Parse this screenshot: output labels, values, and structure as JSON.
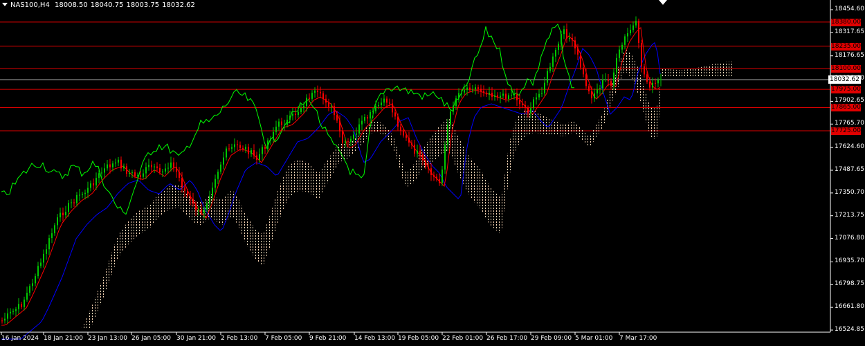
{
  "header": {
    "symbol": "NAS100,H4",
    "open": "18008.50",
    "high": "18040.75",
    "low": "18003.75",
    "close": "18032.62"
  },
  "y_axis": [
    {
      "label": "18454.60",
      "value": 18454.6
    },
    {
      "label": "18317.65",
      "value": 18317.65
    },
    {
      "label": "18176.65",
      "value": 18176.65
    },
    {
      "label": "18039.60",
      "value": 18039.6
    },
    {
      "label": "17902.65",
      "value": 17902.65
    },
    {
      "label": "17765.70",
      "value": 17765.7
    },
    {
      "label": "17624.60",
      "value": 17624.6
    },
    {
      "label": "17487.65",
      "value": 17487.65
    },
    {
      "label": "17350.70",
      "value": 17350.7
    },
    {
      "label": "17213.75",
      "value": 17213.75
    },
    {
      "label": "17076.80",
      "value": 17076.8
    },
    {
      "label": "16935.70",
      "value": 16935.7
    },
    {
      "label": "16798.75",
      "value": 16798.75
    },
    {
      "label": "16661.80",
      "value": 16661.8
    },
    {
      "label": "16524.85",
      "value": 16524.85
    }
  ],
  "x_axis": [
    "16 Jan 2024",
    "18 Jan 21:00",
    "23 Jan 13:00",
    "26 Jan 05:00",
    "30 Jan 21:00",
    "2 Feb 13:00",
    "7 Feb 05:00",
    "9 Feb 21:00",
    "14 Feb 13:00",
    "19 Feb 05:00",
    "22 Feb 01:00",
    "26 Feb 17:00",
    "29 Feb 09:00",
    "5 Mar 01:00",
    "7 Mar 17:00"
  ],
  "levels": [
    {
      "label": "18380.00",
      "value": 18380.0
    },
    {
      "label": "18235.00",
      "value": 18235.0
    },
    {
      "label": "18100.00",
      "value": 18100.0
    },
    {
      "label": "17975.00",
      "value": 17975.0
    },
    {
      "label": "17865.00",
      "value": 17865.0
    },
    {
      "label": "17725.00",
      "value": 17725.0
    }
  ],
  "current_price": {
    "label": "18032.62",
    "value": 18032.62
  },
  "colors": {
    "background": "#000000",
    "bull": "#00c800",
    "bear": "#ff0000",
    "tenkan": "#ff0000",
    "kijun": "#0000ff",
    "chikou": "#00ff00",
    "cloud": "#ffdab9",
    "level": "#e00000"
  },
  "chart_data": {
    "type": "candlestick",
    "title": "NAS100,H4",
    "ylim": [
      16524.85,
      18454.6
    ],
    "x_range": [
      "16 Jan 2024",
      "7 Mar 17:00"
    ],
    "indicators": [
      "Ichimoku (tenkan, kijun, chikou, cloud)"
    ],
    "close_path": [
      [
        "16 Jan 2024",
        16600
      ],
      [
        "18 Jan 21:00",
        17430
      ],
      [
        "23 Jan 13:00",
        17550
      ],
      [
        "26 Jan 05:00",
        17520
      ],
      [
        "30 Jan 21:00",
        17280
      ],
      [
        "2 Feb 13:00",
        17640
      ],
      [
        "7 Feb 05:00",
        17830
      ],
      [
        "9 Feb 21:00",
        17890
      ],
      [
        "14 Feb 13:00",
        17800
      ],
      [
        "19 Feb 05:00",
        17480
      ],
      [
        "22 Feb 01:00",
        17950
      ],
      [
        "26 Feb 17:00",
        17950
      ],
      [
        "29 Feb 09:00",
        18300
      ],
      [
        "5 Mar 01:00",
        17950
      ],
      [
        "7 Mar 17:00",
        18032.62
      ]
    ]
  }
}
